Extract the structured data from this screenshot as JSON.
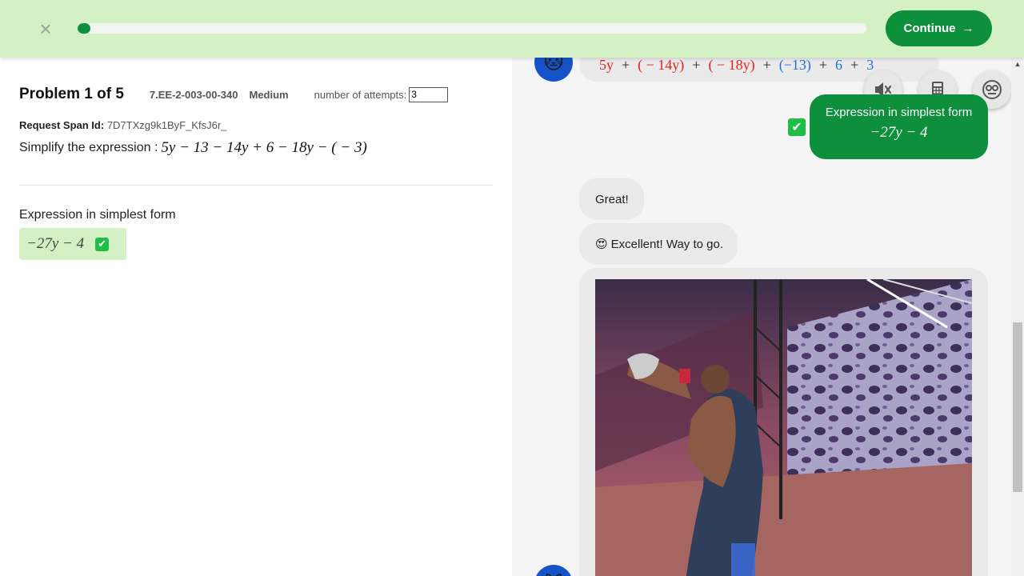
{
  "topbar": {
    "close_icon": "×",
    "progress_fraction": 0.01,
    "continue_label": "Continue",
    "continue_arrow": "→"
  },
  "problem": {
    "title": "Problem 1 of 5",
    "code": "7.EE-2-003-00-340",
    "difficulty": "Medium",
    "attempts_label": "number of attempts:",
    "attempts_value": "3",
    "span_label": "Request Span Id:",
    "span_value": "7D7TXzg9k1ByF_KfsJ6r_",
    "question_prefix": "Simplify the expression :",
    "question_expr": "5y − 13 − 14y + 6 − 18y − ( − 3)",
    "answer_label": "Expression in simplest form",
    "answer_value": "−27y − 4",
    "answer_check": "✔"
  },
  "chat": {
    "expr_terms": [
      {
        "text": "5y",
        "color": "#e8231f"
      },
      {
        "text": "+",
        "color": "#222222"
      },
      {
        "text": "( − 14y)",
        "color": "#e8231f"
      },
      {
        "text": "+",
        "color": "#222222"
      },
      {
        "text": "( − 18y)",
        "color": "#e8231f"
      },
      {
        "text": "+",
        "color": "#222222"
      },
      {
        "text": "(−13)",
        "color": "#1a73e8"
      },
      {
        "text": "+",
        "color": "#222222"
      },
      {
        "text": "6",
        "color": "#1a73e8"
      },
      {
        "text": "+",
        "color": "#222222"
      },
      {
        "text": "3",
        "color": "#1a73e8"
      }
    ],
    "tools": {
      "mute_icon": "speaker-muted-icon",
      "calculator_icon": "calculator-icon",
      "assistant_icon": "robot-face-icon"
    },
    "user_answer_label": "Expression in simplest form",
    "user_answer_value": "−27y − 4",
    "user_check": "✔",
    "great": "Great!",
    "excellent_emoji": "😍",
    "excellent": "Excellent! Way to go."
  },
  "colors": {
    "topbar_bg": "#d3f1c4",
    "brand_green": "#0d8f3c",
    "avatar_blue": "#1554c8"
  }
}
